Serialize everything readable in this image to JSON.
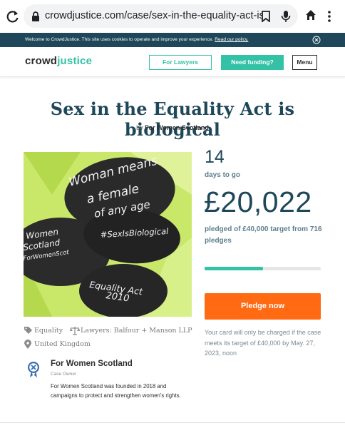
{
  "browser": {
    "url": "crowdjustice.com/case/sex-in-the-equality-act-is-biologi"
  },
  "cookie_banner": {
    "text": "Welcome to CrowdJustice. This site uses cookies to operate and improve your experience.",
    "link": "Read our policy."
  },
  "header": {
    "logo_part1": "crowd",
    "logo_part2": "justice",
    "lawyers_label": "For Lawyers",
    "funding_label": "Need funding?",
    "menu_label": "Menu"
  },
  "case": {
    "title": "Sex in the Equality Act is biological",
    "by": "by",
    "organiser": "For Women Scotland"
  },
  "hero": {
    "stone1_line1": "Woman means",
    "stone1_line2": "a female",
    "stone1_line3": "of any age",
    "stone2": "#SexIsBiological",
    "stone3_line1": "Women",
    "stone3_line2": "Scotland",
    "stone3_line3": "ForWomenScot",
    "stone4_line1": "Equality Act",
    "stone4_line2": "2010"
  },
  "stats": {
    "days": "14",
    "days_label": "days to go",
    "amount": "£20,022",
    "pledged_text": "pledged of £40,000 target from 716 pledges",
    "progress": 0.5,
    "pledge_button": "Pledge now",
    "charge_note": "Your card will only be charged if the case meets its target of £40,000 by May. 27, 2023, noon"
  },
  "tags": {
    "category": "Equality",
    "lawyers": "Lawyers: Balfour + Manson LLP",
    "location": "United Kingdom"
  },
  "owner": {
    "name": "For Women Scotland",
    "role": "Case Owner",
    "description": "For Women Scotland was founded in 2018 and campaigns to protect and strengthen women's rights."
  },
  "colors": {
    "teal": "#33c2a5",
    "navy": "#1e4759",
    "orange": "#ff6a13"
  }
}
